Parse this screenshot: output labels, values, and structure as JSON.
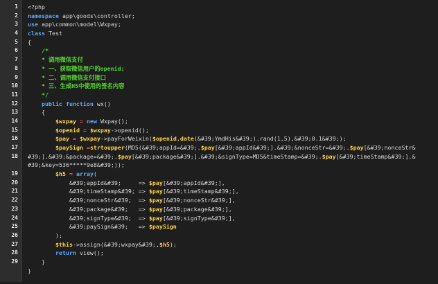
{
  "editor": {
    "line_numbers": [
      "1",
      "2",
      "3",
      "4",
      "5",
      "6",
      "7",
      "8",
      "9",
      "10",
      "11",
      "12",
      "13",
      "14",
      "15",
      "16",
      "17",
      "18",
      "",
      "19",
      "20",
      "21",
      "22",
      "23",
      "24",
      "25",
      "26",
      "27",
      "28",
      "29",
      "",
      ""
    ],
    "lines": [
      [
        {
          "t": "<?php",
          "c": "pl"
        }
      ],
      [
        {
          "t": "namespace",
          "c": "kw"
        },
        {
          "t": " app\\goods\\controller;",
          "c": "pl"
        }
      ],
      [
        {
          "t": "use",
          "c": "kw"
        },
        {
          "t": " app\\common\\model\\Wxpay;",
          "c": "pl"
        }
      ],
      [
        {
          "t": "class",
          "c": "kw"
        },
        {
          "t": " Test",
          "c": "pl"
        }
      ],
      [
        {
          "t": "{",
          "c": "pl"
        }
      ],
      [
        {
          "t": "    /*",
          "c": "cm"
        }
      ],
      [
        {
          "t": "    * 调用微信支付",
          "c": "cm"
        }
      ],
      [
        {
          "t": "    * 一、获取微信用户的openid;",
          "c": "cm"
        }
      ],
      [
        {
          "t": "    * 二、调用微信支付接口",
          "c": "cm"
        }
      ],
      [
        {
          "t": "    * 三、生成H5中使用的签名内容",
          "c": "cm"
        }
      ],
      [
        {
          "t": "    */",
          "c": "cm"
        }
      ],
      [
        {
          "t": "    ",
          "c": "pl"
        },
        {
          "t": "public function",
          "c": "kw"
        },
        {
          "t": " wx()",
          "c": "pl"
        }
      ],
      [
        {
          "t": "    {",
          "c": "pl"
        }
      ],
      [
        {
          "t": "        ",
          "c": "pl"
        },
        {
          "t": "$wxpay",
          "c": "var"
        },
        {
          "t": " = ",
          "c": "op"
        },
        {
          "t": "new",
          "c": "kw"
        },
        {
          "t": " Wxpay();",
          "c": "pl"
        }
      ],
      [
        {
          "t": "        ",
          "c": "pl"
        },
        {
          "t": "$openid",
          "c": "var"
        },
        {
          "t": " = ",
          "c": "op"
        },
        {
          "t": "$wxpay",
          "c": "var"
        },
        {
          "t": "->openid();",
          "c": "pl"
        }
      ],
      [
        {
          "t": "        ",
          "c": "pl"
        },
        {
          "t": "$pay",
          "c": "var"
        },
        {
          "t": " = ",
          "c": "op"
        },
        {
          "t": "$wxpay",
          "c": "var"
        },
        {
          "t": "->payForWeixin(",
          "c": "pl"
        },
        {
          "t": "$openid",
          "c": "var"
        },
        {
          "t": ",",
          "c": "pl"
        },
        {
          "t": "date",
          "c": "fn"
        },
        {
          "t": "(&#39;YmdHis&#39;).rand(1,5),&#39;0.1&#39;);",
          "c": "pl"
        }
      ],
      [
        {
          "t": "        ",
          "c": "pl"
        },
        {
          "t": "$paySign",
          "c": "var"
        },
        {
          "t": " =",
          "c": "op"
        },
        {
          "t": "strtoupper",
          "c": "fn"
        },
        {
          "t": "(MD5(&#39;appId=&#39;.",
          "c": "pl"
        },
        {
          "t": "$pay",
          "c": "var"
        },
        {
          "t": "[&#39;appId&#39;].&#39;&nonceStr=&#39;.",
          "c": "pl"
        },
        {
          "t": "$pay",
          "c": "var"
        },
        {
          "t": "[&#39;nonceStr&",
          "c": "pl"
        }
      ],
      [
        {
          "t": "#39;].&#39;&package=&#39;.",
          "c": "pl"
        },
        {
          "t": "$pay",
          "c": "var"
        },
        {
          "t": "[&#39;package&#39;].&#39;&signType=MD5&timeStamp=&#39;.",
          "c": "pl"
        },
        {
          "t": "$pay",
          "c": "var"
        },
        {
          "t": "[&#39;timeStamp&#39;].&",
          "c": "pl"
        }
      ],
      [
        {
          "t": "#39;&key=536*****9e8&#39;));",
          "c": "pl"
        }
      ],
      [
        {
          "t": "        ",
          "c": "pl"
        },
        {
          "t": "$h5",
          "c": "var"
        },
        {
          "t": " = ",
          "c": "op"
        },
        {
          "t": "array",
          "c": "kw"
        },
        {
          "t": "(",
          "c": "pl"
        }
      ],
      [
        {
          "t": "            &#39;appId&#39;     => ",
          "c": "pl"
        },
        {
          "t": "$pay",
          "c": "var"
        },
        {
          "t": "[&#39;appId&#39;],",
          "c": "pl"
        }
      ],
      [
        {
          "t": "            &#39;timeStamp&#39; => ",
          "c": "pl"
        },
        {
          "t": "$pay",
          "c": "var"
        },
        {
          "t": "[&#39;timeStamp&#39;],",
          "c": "pl"
        }
      ],
      [
        {
          "t": "            &#39;nonceStr&#39;  => ",
          "c": "pl"
        },
        {
          "t": "$pay",
          "c": "var"
        },
        {
          "t": "[&#39;nonceStr&#39;],",
          "c": "pl"
        }
      ],
      [
        {
          "t": "            &#39;package&#39;   => ",
          "c": "pl"
        },
        {
          "t": "$pay",
          "c": "var"
        },
        {
          "t": "[&#39;package&#39;],",
          "c": "pl"
        }
      ],
      [
        {
          "t": "            &#39;signType&#39;  => ",
          "c": "pl"
        },
        {
          "t": "$pay",
          "c": "var"
        },
        {
          "t": "[&#39;signType&#39;],",
          "c": "pl"
        }
      ],
      [
        {
          "t": "            &#39;paySign&#39;   => ",
          "c": "pl"
        },
        {
          "t": "$paySign",
          "c": "var"
        }
      ],
      [
        {
          "t": "        );",
          "c": "pl"
        }
      ],
      [
        {
          "t": "        ",
          "c": "pl"
        },
        {
          "t": "$this",
          "c": "var"
        },
        {
          "t": "->assign(&#39;wxpay&#39;,",
          "c": "pl"
        },
        {
          "t": "$h5",
          "c": "var"
        },
        {
          "t": ");",
          "c": "pl"
        }
      ],
      [
        {
          "t": "        ",
          "c": "pl"
        },
        {
          "t": "return",
          "c": "kw"
        },
        {
          "t": " view();",
          "c": "pl"
        }
      ],
      [
        {
          "t": "    }",
          "c": "pl"
        }
      ],
      [
        {
          "t": "}",
          "c": "pl"
        }
      ]
    ]
  },
  "colors": {
    "background": "#1e1e1e",
    "keyword": "#5aa9ff",
    "variable": "#ffd24a",
    "comment": "#58d634",
    "operator": "#ff5050"
  }
}
